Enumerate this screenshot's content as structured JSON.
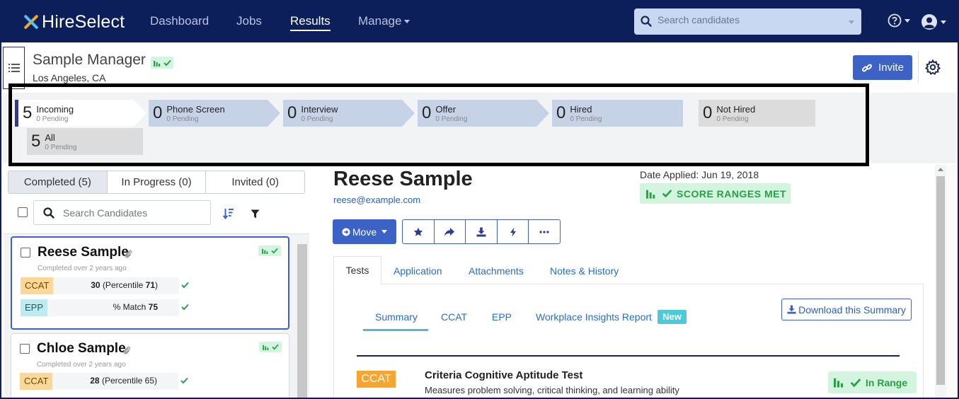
{
  "nav": {
    "brand": "HireSelect",
    "items": [
      {
        "label": "Dashboard",
        "active": false
      },
      {
        "label": "Jobs",
        "active": false
      },
      {
        "label": "Results",
        "active": true
      },
      {
        "label": "Manage",
        "active": false
      }
    ],
    "search_placeholder": "Search candidates"
  },
  "header": {
    "title": "Sample Manager",
    "location": "Los Angeles, CA",
    "invite_label": "Invite"
  },
  "pipeline": [
    {
      "count": "5",
      "name": "Incoming",
      "pending": "0 Pending"
    },
    {
      "count": "0",
      "name": "Phone Screen",
      "pending": "0 Pending"
    },
    {
      "count": "0",
      "name": "Interview",
      "pending": "0 Pending"
    },
    {
      "count": "0",
      "name": "Offer",
      "pending": "0 Pending"
    },
    {
      "count": "0",
      "name": "Hired",
      "pending": "0 Pending"
    },
    {
      "count": "0",
      "name": "Not Hired",
      "pending": "0 Pending"
    },
    {
      "count": "5",
      "name": "All",
      "pending": "0 Pending"
    }
  ],
  "candidate_tabs": [
    "Completed (5)",
    "In Progress (0)",
    "Invited (0)"
  ],
  "candidate_search_placeholder": "Search Candidates",
  "candidates": [
    {
      "name": "Reese Sample",
      "completed": "Completed over 2 years ago",
      "scores": [
        {
          "test": "CCAT",
          "value": "30",
          "detail": "(Percentile ",
          "detail_num": "71",
          "detail_end": ")"
        },
        {
          "test": "EPP",
          "prefix": "% Match ",
          "value": "75"
        }
      ]
    },
    {
      "name": "Chloe Sample",
      "completed": "Completed over 2 years ago",
      "scores": [
        {
          "test": "CCAT",
          "value": "28",
          "detail": "(Percentile 65)"
        }
      ]
    }
  ],
  "detail": {
    "name": "Reese Sample",
    "email": "reese@example.com",
    "date_applied": "Date Applied: Jun 19, 2018",
    "score_status": "SCORE RANGES MET",
    "move_label": "Move",
    "tabs": [
      "Tests",
      "Application",
      "Attachments",
      "Notes & History"
    ],
    "sub_tabs": [
      "Summary",
      "CCAT",
      "EPP",
      "Workplace Insights Report"
    ],
    "new_badge": "New",
    "download_label": "Download this Summary",
    "test": {
      "tag": "CCAT",
      "title": "Criteria Cognitive Aptitude Test",
      "description": "Measures problem solving, critical thinking, and learning ability",
      "status": "In Range"
    }
  },
  "colors": {
    "nav_bg": "#0c1f5a",
    "primary": "#3d62c5",
    "success_bg": "#d3f5df",
    "success_text": "#2aa046",
    "ccat": "#f7a52e",
    "epp": "#bcecf0"
  }
}
